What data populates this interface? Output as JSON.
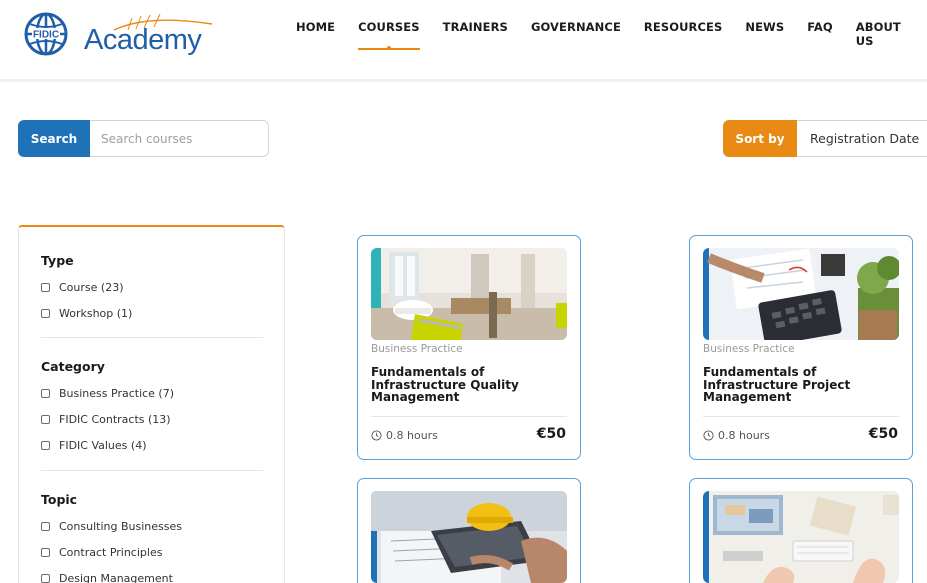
{
  "brand": {
    "logo_text": "Academy",
    "globe_text": "FIDIC"
  },
  "nav": {
    "items": [
      {
        "label": "HOME"
      },
      {
        "label": "COURSES",
        "active": true
      },
      {
        "label": "TRAINERS"
      },
      {
        "label": "GOVERNANCE"
      },
      {
        "label": "RESOURCES"
      },
      {
        "label": "NEWS"
      },
      {
        "label": "FAQ"
      },
      {
        "label": "ABOUT US"
      }
    ]
  },
  "search": {
    "button_label": "Search",
    "placeholder": "Search courses",
    "value": ""
  },
  "sort": {
    "button_label": "Sort by",
    "selected": "Registration Date"
  },
  "filters": {
    "type": {
      "title": "Type",
      "options": [
        "Course (23)",
        "Workshop (1)"
      ]
    },
    "category": {
      "title": "Category",
      "options": [
        "Business Practice (7)",
        "FIDIC Contracts (13)",
        "FIDIC Values (4)"
      ]
    },
    "topic": {
      "title": "Topic",
      "options": [
        "Consulting Businesses",
        "Contract Principles",
        "Design Management"
      ]
    }
  },
  "courses": [
    {
      "category": "Business Practice",
      "title": "Fundamentals of Infrastructure Quality Management",
      "duration": "0.8 hours",
      "price": "€50",
      "image": "construction-site"
    },
    {
      "category": "Business Practice",
      "title": "Fundamentals of Infrastructure Project Management",
      "duration": "0.8 hours",
      "price": "€50",
      "image": "calculator-desk"
    },
    {
      "category": "",
      "title": "",
      "duration": "",
      "price": "",
      "image": "engineer-laptop"
    },
    {
      "category": "",
      "title": "",
      "duration": "",
      "price": "",
      "image": "office-desk"
    }
  ],
  "colors": {
    "primary": "#1f72b8",
    "accent": "#e88a14",
    "card_border": "#5aa0d8"
  }
}
